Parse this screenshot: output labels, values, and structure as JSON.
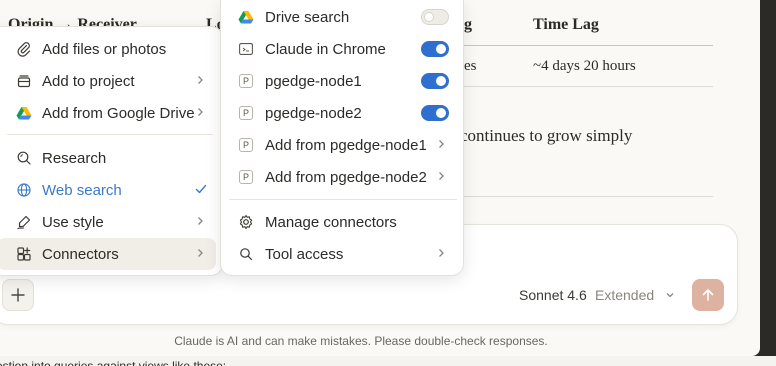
{
  "background": {
    "table": {
      "headers": [
        "Origin → Receiver",
        "Lo",
        "g",
        "Time Lag"
      ],
      "row_fragment": "es",
      "row_time_lag": "~4 days 20 hours"
    },
    "body_fragment": "continues to grow simply",
    "bottom_fragment": "estion into queries against views like these:"
  },
  "composer": {
    "model_name": "Sonnet 4.6",
    "model_mode": "Extended"
  },
  "disclaimer": "Claude is AI and can make mistakes. Please double-check responses.",
  "left_menu": {
    "items": [
      {
        "label": "Add files or photos",
        "icon": "paperclip-icon"
      },
      {
        "label": "Add to project",
        "icon": "project-icon"
      },
      {
        "label": "Add from Google Drive",
        "icon": "google-drive-icon"
      },
      {
        "label": "Research",
        "icon": "research-icon"
      },
      {
        "label": "Web search",
        "icon": "globe-icon",
        "checked": true
      },
      {
        "label": "Use style",
        "icon": "pen-icon"
      },
      {
        "label": "Connectors",
        "icon": "connectors-icon"
      }
    ]
  },
  "right_menu": {
    "items": [
      {
        "label": "Drive search",
        "icon": "google-drive-icon",
        "toggle": false
      },
      {
        "label": "Claude in Chrome",
        "icon": "browser-icon",
        "toggle": true
      },
      {
        "label": "pgedge-node1",
        "icon": "p-icon",
        "toggle": true
      },
      {
        "label": "pgedge-node2",
        "icon": "p-icon",
        "toggle": true
      },
      {
        "label": "Add from pgedge-node1",
        "icon": "p-icon"
      },
      {
        "label": "Add from pgedge-node2",
        "icon": "p-icon"
      },
      {
        "label": "Manage connectors",
        "icon": "gear-icon"
      },
      {
        "label": "Tool access",
        "icon": "search-icon"
      }
    ]
  },
  "colors": {
    "accent": "#2f6fcf",
    "send": "#deb2a1",
    "active_text": "#3b7ac8"
  }
}
